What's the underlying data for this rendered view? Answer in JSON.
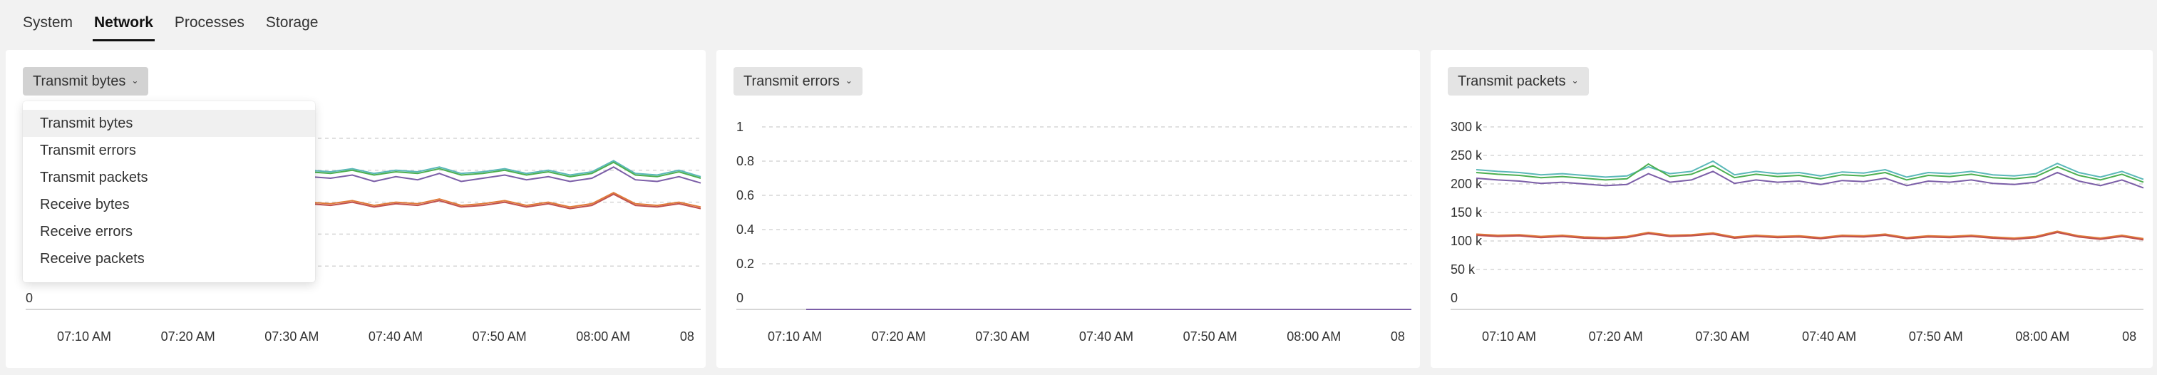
{
  "tabs": [
    {
      "label": "System",
      "active": false
    },
    {
      "label": "Network",
      "active": true
    },
    {
      "label": "Processes",
      "active": false
    },
    {
      "label": "Storage",
      "active": false
    }
  ],
  "panels": [
    {
      "dropdown_label": "Transmit bytes",
      "menu_open": true,
      "menu_items": [
        "Transmit bytes",
        "Transmit errors",
        "Transmit packets",
        "Receive bytes",
        "Receive errors",
        "Receive packets"
      ],
      "hovered_item": "Transmit bytes"
    },
    {
      "dropdown_label": "Transmit errors",
      "menu_open": false
    },
    {
      "dropdown_label": "Transmit packets",
      "menu_open": false
    }
  ],
  "colors": {
    "series_teal": "#5ab8b8",
    "series_green": "#4caf50",
    "series_purple": "#7b5ea7",
    "series_orange": "#e07b39",
    "series_red": "#c0504d",
    "gridline": "#d6d6d6"
  },
  "chart_data": [
    {
      "type": "line",
      "x_tick_labels": [
        "07:10 AM",
        "07:20 AM",
        "07:30 AM",
        "07:40 AM",
        "07:50 AM",
        "08:00 AM",
        "08"
      ],
      "y_tick_labels": [
        "0"
      ],
      "ylim": [
        0,
        1
      ],
      "grid": true,
      "x": [
        "07:06",
        "07:08",
        "07:10",
        "07:12",
        "07:14",
        "07:16",
        "07:18",
        "07:20",
        "07:22",
        "07:24",
        "07:26",
        "07:28",
        "07:30",
        "07:32",
        "07:34",
        "07:36",
        "07:38",
        "07:40",
        "07:42",
        "07:44",
        "07:46",
        "07:48",
        "07:50",
        "07:52",
        "07:54",
        "07:56",
        "07:58",
        "08:00",
        "08:02",
        "08:04",
        "08:06",
        "08:08"
      ],
      "series": [
        {
          "color": "teal",
          "values": [
            0.78,
            0.77,
            0.79,
            0.78,
            0.8,
            0.77,
            0.78,
            0.79,
            0.8,
            0.78,
            0.81,
            0.79,
            0.78,
            0.8,
            0.79,
            0.81,
            0.78,
            0.8,
            0.79,
            0.82,
            0.78,
            0.79,
            0.81,
            0.78,
            0.8,
            0.77,
            0.79,
            0.86,
            0.78,
            0.77,
            0.8,
            0.76
          ]
        },
        {
          "color": "green",
          "values": [
            0.77,
            0.76,
            0.78,
            0.77,
            0.79,
            0.76,
            0.77,
            0.78,
            0.79,
            0.77,
            0.8,
            0.78,
            0.77,
            0.79,
            0.78,
            0.8,
            0.77,
            0.79,
            0.78,
            0.81,
            0.77,
            0.78,
            0.8,
            0.77,
            0.79,
            0.76,
            0.78,
            0.85,
            0.77,
            0.76,
            0.79,
            0.75
          ]
        },
        {
          "color": "purple",
          "values": [
            0.74,
            0.73,
            0.75,
            0.72,
            0.76,
            0.73,
            0.74,
            0.75,
            0.76,
            0.74,
            0.77,
            0.75,
            0.72,
            0.76,
            0.75,
            0.77,
            0.73,
            0.76,
            0.74,
            0.78,
            0.73,
            0.75,
            0.77,
            0.74,
            0.76,
            0.73,
            0.75,
            0.82,
            0.74,
            0.73,
            0.76,
            0.72
          ]
        },
        {
          "color": "orange",
          "values": [
            0.59,
            0.58,
            0.6,
            0.59,
            0.6,
            0.58,
            0.59,
            0.6,
            0.61,
            0.58,
            0.61,
            0.59,
            0.58,
            0.6,
            0.59,
            0.61,
            0.58,
            0.6,
            0.59,
            0.62,
            0.58,
            0.59,
            0.61,
            0.58,
            0.6,
            0.57,
            0.59,
            0.66,
            0.59,
            0.58,
            0.6,
            0.57
          ]
        },
        {
          "color": "red",
          "values": [
            0.58,
            0.57,
            0.59,
            0.58,
            0.59,
            0.57,
            0.58,
            0.59,
            0.6,
            0.57,
            0.6,
            0.58,
            0.57,
            0.59,
            0.58,
            0.6,
            0.57,
            0.59,
            0.58,
            0.61,
            0.57,
            0.58,
            0.6,
            0.57,
            0.59,
            0.56,
            0.58,
            0.65,
            0.58,
            0.57,
            0.59,
            0.56
          ]
        }
      ]
    },
    {
      "type": "line",
      "x_tick_labels": [
        "07:10 AM",
        "07:20 AM",
        "07:30 AM",
        "07:40 AM",
        "07:50 AM",
        "08:00 AM",
        "08"
      ],
      "y_tick_labels": [
        "0",
        "0.2",
        "0.4",
        "0.6",
        "0.8",
        "1"
      ],
      "ylim": [
        0,
        1
      ],
      "grid": true,
      "x": [
        "07:08",
        "08:10"
      ],
      "series": [
        {
          "color": "purple",
          "values": [
            0,
            0
          ]
        }
      ]
    },
    {
      "type": "line",
      "x_tick_labels": [
        "07:10 AM",
        "07:20 AM",
        "07:30 AM",
        "07:40 AM",
        "07:50 AM",
        "08:00 AM",
        "08"
      ],
      "y_tick_labels": [
        "0",
        "50 k",
        "100 k",
        "150 k",
        "200 k",
        "250 k",
        "300 k"
      ],
      "ylim": [
        0,
        300000
      ],
      "grid": true,
      "x": [
        "07:06",
        "07:08",
        "07:10",
        "07:12",
        "07:14",
        "07:16",
        "07:18",
        "07:20",
        "07:22",
        "07:24",
        "07:26",
        "07:28",
        "07:30",
        "07:32",
        "07:34",
        "07:36",
        "07:38",
        "07:40",
        "07:42",
        "07:44",
        "07:46",
        "07:48",
        "07:50",
        "07:52",
        "07:54",
        "07:56",
        "07:58",
        "08:00",
        "08:02",
        "08:04",
        "08:06",
        "08:08"
      ],
      "series": [
        {
          "color": "teal",
          "values": [
            225000,
            222000,
            220000,
            216000,
            218000,
            215000,
            212000,
            214000,
            230000,
            218000,
            222000,
            240000,
            216000,
            222000,
            218000,
            220000,
            214000,
            221000,
            219000,
            225000,
            212000,
            220000,
            218000,
            222000,
            216000,
            214000,
            218000,
            236000,
            220000,
            212000,
            222000,
            208000
          ]
        },
        {
          "color": "green",
          "values": [
            220000,
            217000,
            215000,
            211000,
            213000,
            210000,
            207000,
            209000,
            235000,
            213000,
            217000,
            232000,
            211000,
            217000,
            213000,
            215000,
            209000,
            216000,
            214000,
            220000,
            207000,
            215000,
            213000,
            217000,
            211000,
            209000,
            213000,
            230000,
            215000,
            207000,
            217000,
            203000
          ]
        },
        {
          "color": "purple",
          "values": [
            210000,
            207000,
            205000,
            201000,
            203000,
            200000,
            197000,
            199000,
            218000,
            203000,
            207000,
            222000,
            201000,
            207000,
            203000,
            205000,
            199000,
            206000,
            204000,
            210000,
            197000,
            205000,
            203000,
            207000,
            201000,
            199000,
            203000,
            220000,
            205000,
            197000,
            207000,
            193000
          ]
        },
        {
          "color": "orange",
          "values": [
            112000,
            110000,
            111000,
            108000,
            110000,
            107000,
            106000,
            108000,
            115000,
            110000,
            111000,
            114000,
            107000,
            110000,
            108000,
            109000,
            106000,
            110000,
            109000,
            112000,
            106000,
            109000,
            108000,
            110000,
            107000,
            105000,
            108000,
            117000,
            109000,
            105000,
            110000,
            104000
          ]
        },
        {
          "color": "red",
          "values": [
            110000,
            108000,
            109000,
            106000,
            108000,
            105000,
            104000,
            106000,
            113000,
            108000,
            109000,
            112000,
            105000,
            108000,
            106000,
            107000,
            104000,
            108000,
            107000,
            110000,
            104000,
            107000,
            106000,
            108000,
            105000,
            103000,
            106000,
            115000,
            107000,
            103000,
            108000,
            102000
          ]
        }
      ]
    }
  ]
}
